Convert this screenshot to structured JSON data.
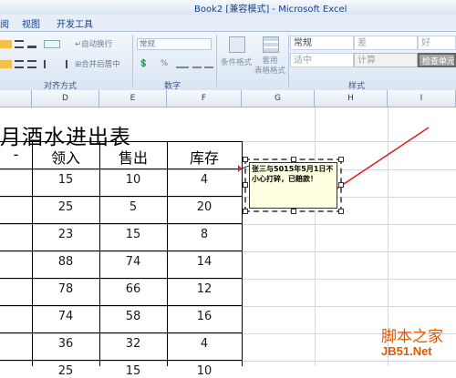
{
  "window": {
    "title": "Book2  [兼容模式] - Microsoft Excel"
  },
  "tabs": [
    "阅",
    "视图",
    "开发工具"
  ],
  "ribbon": {
    "wrap_text": "自动换行",
    "merge_center": "合并后居中",
    "number_format": "常规",
    "percent": "%",
    "conditional_format": "条件格式",
    "format_table": "套用\n表格格式",
    "group_alignment": "对齐方式",
    "group_number": "数字",
    "group_styles": "样式",
    "styles": [
      "常规",
      "差",
      "好",
      "适中",
      "计算",
      "检查单元"
    ]
  },
  "columns": [
    "D",
    "E",
    "F",
    "G",
    "H",
    "I"
  ],
  "sheet": {
    "title": "月酒水进出表",
    "header": [
      "领入",
      "售出",
      "库存"
    ],
    "rows": [
      [
        "15",
        "10",
        "4"
      ],
      [
        "25",
        "5",
        "20"
      ],
      [
        "23",
        "15",
        "8"
      ],
      [
        "88",
        "74",
        "14"
      ],
      [
        "78",
        "66",
        "12"
      ],
      [
        "74",
        "58",
        "16"
      ],
      [
        "36",
        "32",
        "4"
      ],
      [
        "25",
        "15",
        "10"
      ]
    ]
  },
  "comment": {
    "text": "张三与5015年5月1日不小心打碎，已赔款！"
  },
  "watermark": {
    "line1": "脚本之家",
    "line2": "JB51.Net"
  },
  "colors": {
    "arrow": "#e02020",
    "comment_bg": "#ffffe1"
  }
}
